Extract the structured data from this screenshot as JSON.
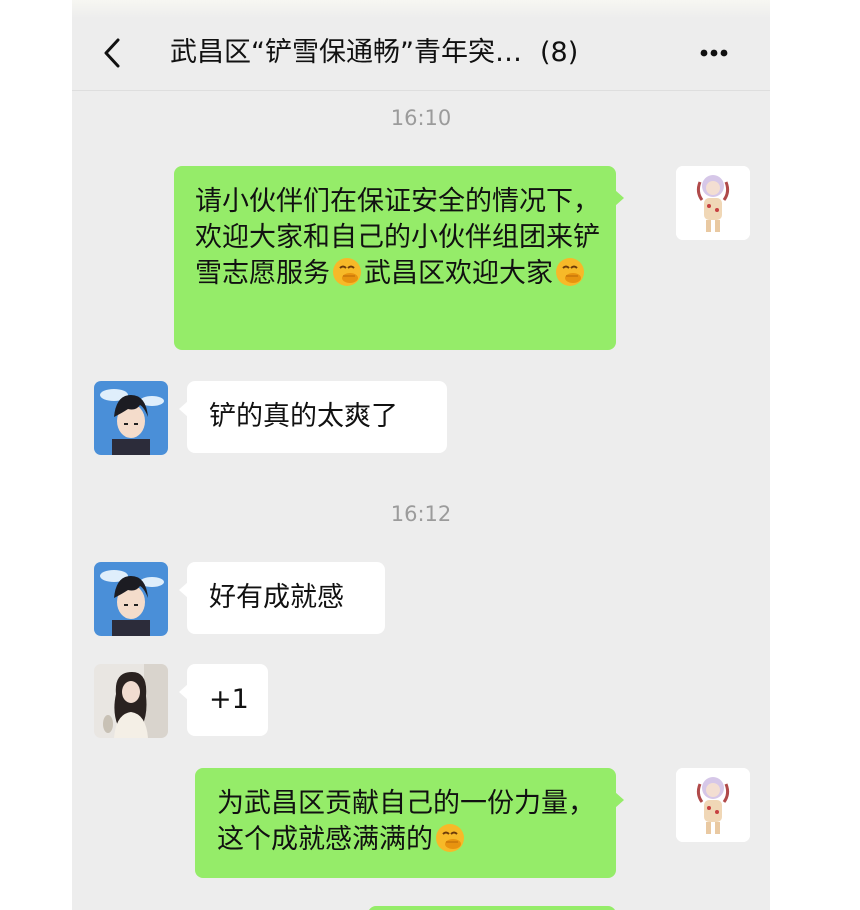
{
  "header": {
    "title": "武昌区“铲雪保通畅”青年突…",
    "member_count": "(8)",
    "back_icon": "chevron-left-icon",
    "more_icon": "more-dots-icon"
  },
  "timestamps": [
    "16:10",
    "16:12"
  ],
  "messages": [
    {
      "sender": "me",
      "parts": [
        "请小伙伴们在保证安全的情况下，欢迎大家和自己的小伙伴组团来铲雪志愿服务",
        "武昌区欢迎大家"
      ],
      "emoji": "face-with-hand-over-mouth-emoji"
    },
    {
      "sender": "other",
      "text": "铲的真的太爽了"
    },
    {
      "sender": "other",
      "text": "好有成就感"
    },
    {
      "sender": "other2",
      "text": "+1"
    },
    {
      "sender": "me",
      "parts": [
        "为武昌区贡献自己的一份力量，这个成就感满满的"
      ],
      "emoji": "face-with-hand-over-mouth-emoji"
    }
  ],
  "colors": {
    "chat_background": "#ededed",
    "my_bubble": "#95ec69",
    "other_bubble": "#ffffff",
    "timestamp_text": "#9b9b9b"
  }
}
